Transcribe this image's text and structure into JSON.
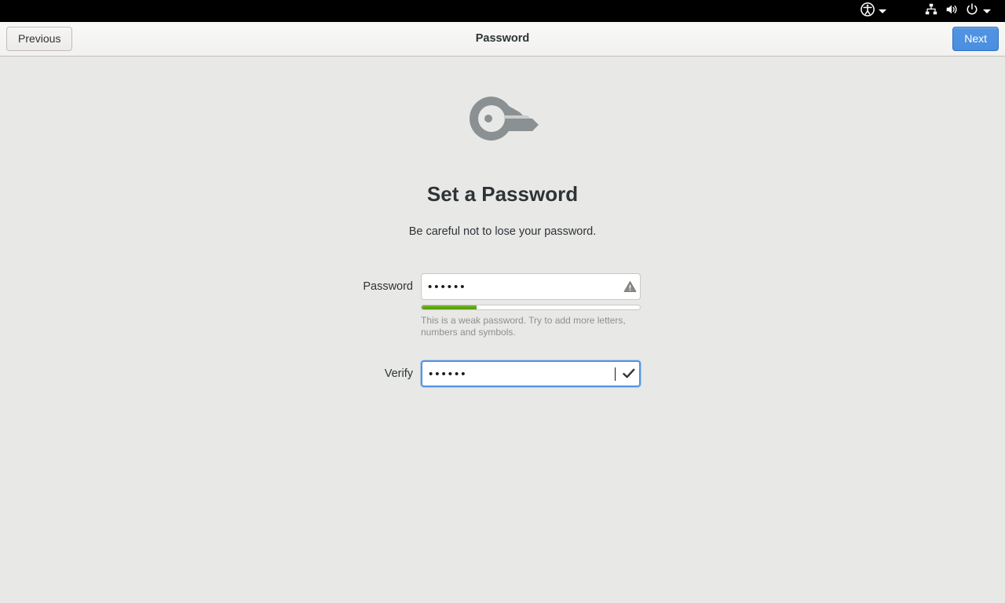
{
  "topbar": {
    "icons": [
      {
        "name": "accessibility-icon",
        "glyph": "accessibility"
      },
      {
        "name": "network-icon",
        "glyph": "network"
      },
      {
        "name": "volume-icon",
        "glyph": "volume"
      },
      {
        "name": "power-icon",
        "glyph": "power"
      }
    ]
  },
  "header": {
    "title": "Password",
    "previous_label": "Previous",
    "next_label": "Next",
    "next_accent": "#5294e2"
  },
  "main": {
    "icon_name": "key-icon",
    "title": "Set a Password",
    "subtitle": "Be careful not to lose your password."
  },
  "form": {
    "password": {
      "label": "Password",
      "value": "••••••",
      "placeholder": "",
      "status_icon": "warning-icon",
      "focused": false
    },
    "strength": {
      "percent": 25,
      "color": "#4e9a06",
      "hint": "This is a weak password. Try to add more letters, numbers and symbols."
    },
    "verify": {
      "label": "Verify",
      "value": "••••••",
      "placeholder": "",
      "status_icon": "check-icon",
      "focused": true
    }
  }
}
